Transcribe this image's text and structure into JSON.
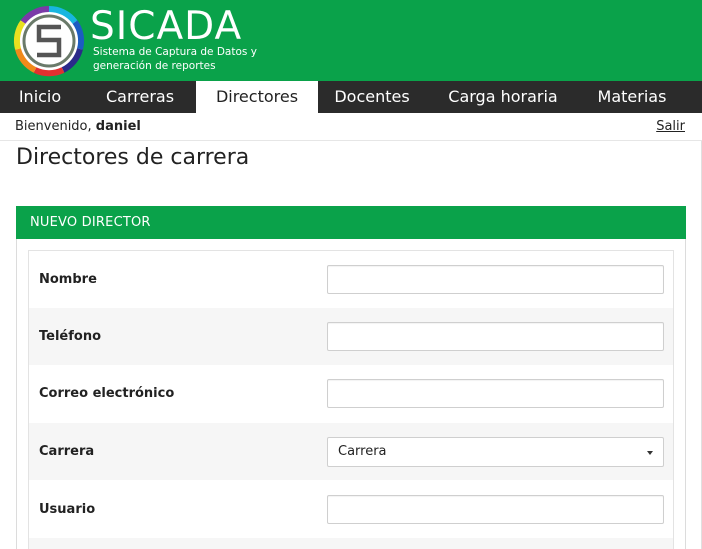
{
  "brand": {
    "title": "SICADA",
    "subtitle": "Sistema de Captura de Datos y generación de reportes",
    "colors": {
      "primary": "#0aa24a",
      "nav": "#2b2b2b"
    }
  },
  "nav": {
    "items": [
      {
        "label": "Inicio"
      },
      {
        "label": "Carreras"
      },
      {
        "label": "Directores"
      },
      {
        "label": "Docentes"
      },
      {
        "label": "Carga horaria"
      },
      {
        "label": "Materias"
      }
    ]
  },
  "user": {
    "greeting": "Bienvenido,",
    "name": "daniel",
    "logout_label": "Salir"
  },
  "page": {
    "title": "Directores de carrera"
  },
  "form": {
    "heading": "NUEVO DIRECTOR",
    "fields": [
      {
        "label": "Nombre",
        "value": ""
      },
      {
        "label": "Teléfono",
        "value": ""
      },
      {
        "label": "Correo electrónico",
        "value": ""
      },
      {
        "label": "Carrera",
        "selected": "Carrera"
      },
      {
        "label": "Usuario",
        "value": ""
      }
    ]
  }
}
